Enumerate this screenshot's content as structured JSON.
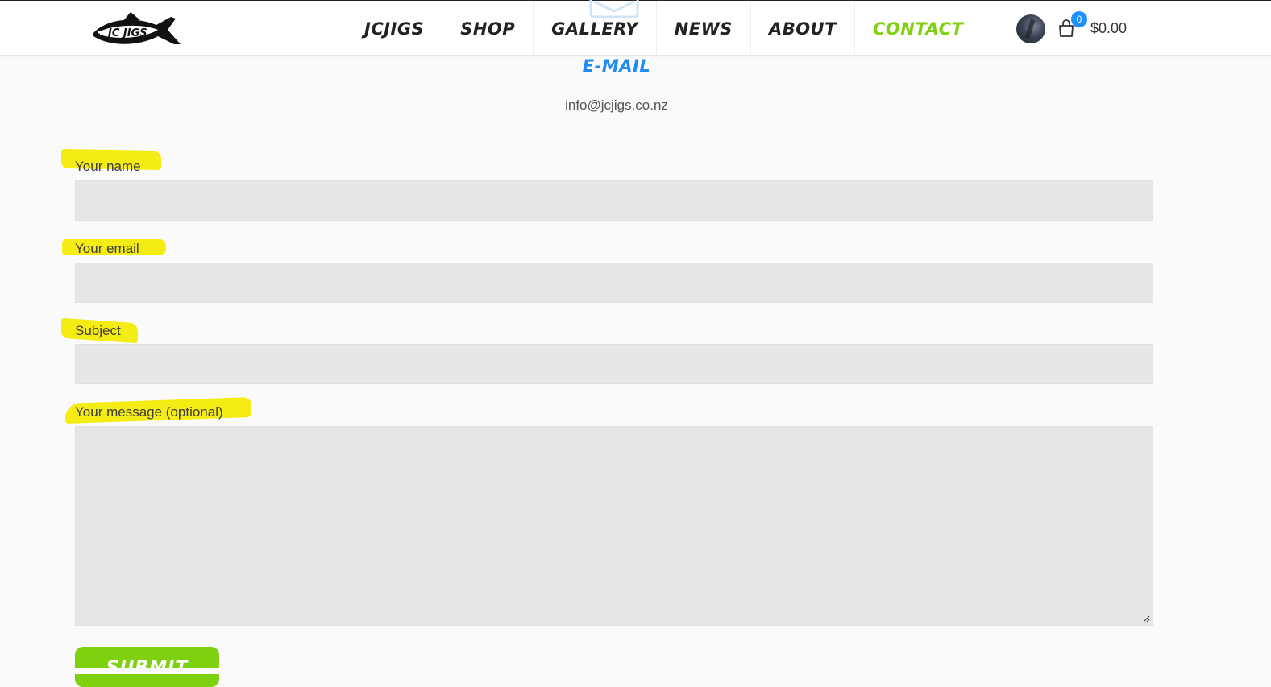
{
  "brand": {
    "logo_text": "JC JIGS"
  },
  "nav": {
    "items": [
      {
        "label": "JCJIGS",
        "active": false
      },
      {
        "label": "SHOP",
        "active": false
      },
      {
        "label": "GALLERY",
        "active": false
      },
      {
        "label": "NEWS",
        "active": false
      },
      {
        "label": "ABOUT",
        "active": false
      },
      {
        "label": "CONTACT",
        "active": true
      }
    ]
  },
  "account": {
    "avatar_icon": "user-avatar"
  },
  "cart": {
    "icon": "shopping-bag-icon",
    "count": "0",
    "total": "$0.00"
  },
  "contact": {
    "heading": "E-MAIL",
    "email": "info@jcjigs.co.nz",
    "header_icon": "envelope-icon"
  },
  "form": {
    "name_label": "Your name",
    "name_value": "",
    "email_label": "Your email",
    "email_value": "",
    "subject_label": "Subject",
    "subject_value": "",
    "message_label": "Your message (optional)",
    "message_value": "",
    "submit_label": "SUBMIT"
  },
  "colors": {
    "accent_green": "#7fd10f",
    "accent_blue": "#1e8cf0",
    "highlight_yellow": "#f4ea00",
    "input_bg": "#e6e6e6"
  }
}
